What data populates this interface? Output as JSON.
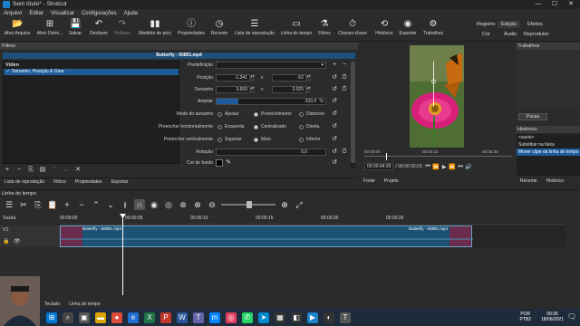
{
  "window": {
    "title": "Sem título* - Shotcut",
    "minimize": "—",
    "maximize": "☐",
    "close": "✕"
  },
  "menu": [
    "Arquivo",
    "Editar",
    "Visualizar",
    "Configurações",
    "Ajuda"
  ],
  "toolbar": {
    "items": [
      "Abrir Arquivo",
      "Abrir Outro...",
      "Salvar",
      "Desfazer",
      "Refazer",
      "Medidor de pico",
      "Propriedades",
      "Recente",
      "Lista de reprodução",
      "Linha do tempo",
      "Filtros",
      "Chaves-chave",
      "Histórico",
      "Exportar",
      "Trabalhos"
    ],
    "layouts_top": [
      "Registro",
      "Edição",
      "Efeitos"
    ],
    "layouts_bottom": [
      "Cor",
      "Áudio",
      "Reprodutor"
    ],
    "active_layout": "Edição"
  },
  "filters": {
    "panel_title": "Filtros",
    "clip_name": "Butterfly - 60891.mp4",
    "list_header": "Vídeo",
    "selected_filter": "Tamanho, Posição & Girar",
    "preset_label": "Predefinição",
    "position_label": "Posição",
    "position_x": "-1.341",
    "position_y": "-52",
    "size_label": "Tamanho",
    "size_w": "3.600",
    "size_h": "2.025",
    "zoom_label": "Ampliar",
    "zoom_value": "333,4",
    "zoom_unit": "%",
    "zoom_fraction": 0.2,
    "size_mode_label": "Modo do tamanho",
    "size_mode_options": [
      "Ajustar",
      "Preenchimento",
      "Distorcer"
    ],
    "size_mode_selected": 1,
    "hfill_label": "Preencher horizontalmente",
    "hfill_options": [
      "Esquerda",
      "Centralizado",
      "Direita"
    ],
    "hfill_selected": 1,
    "vfill_label": "Preencher verticalmente",
    "vfill_options": [
      "Superior",
      "Meio",
      "Inferior"
    ],
    "vfill_selected": 1,
    "rotation_label": "Rotação",
    "rotation_value": "0,0",
    "bg_label": "Cor de fundo",
    "x_sep": "x",
    "tools": [
      "+",
      "−",
      "⎘",
      "▤",
      "⌃",
      "⌄",
      "✕"
    ]
  },
  "left_tabs": [
    "Lista de reprodução",
    "Filtros",
    "Propriedades",
    "Exportar"
  ],
  "player": {
    "tc_current": "00:00:04:29",
    "tc_total": "/ 00:00:32:03",
    "tc_in": "00:00:00",
    "scrub_ticks": [
      "00:00:00",
      "00:00:15",
      "00:00:30"
    ],
    "tabs": [
      "Fonte",
      "Projeto"
    ]
  },
  "jobs": {
    "title": "Trabalhos",
    "pause": "Pausa"
  },
  "history": {
    "title": "Histórico",
    "items": [
      "<vazio>",
      "Substituir na faixa",
      "Mover clipe da linha do tempo"
    ],
    "selected": 2
  },
  "right_tabs": [
    "Recente",
    "Histórico"
  ],
  "timeline": {
    "title": "Linha do tempo",
    "ruler": [
      "00:00:00",
      "00:00:05",
      "00:00:10",
      "00:00:15",
      "00:00:20",
      "00:00:25"
    ],
    "track_output": "Saída",
    "track_name": "V1",
    "clip_label": "Butterfly - 60891.mp4",
    "clip_label_end": "Butterfly - 60891.mp4",
    "bottom_tabs": [
      "Teclado",
      "Linha do tempo"
    ]
  },
  "taskbar": {
    "lang": "POR",
    "layout": "PTB2",
    "time": "09:36",
    "date": "18/06/2021"
  },
  "colors": {
    "accent": "#1f5c9b",
    "clip": "#1b5275",
    "taskbar": "#1e2b3a"
  }
}
